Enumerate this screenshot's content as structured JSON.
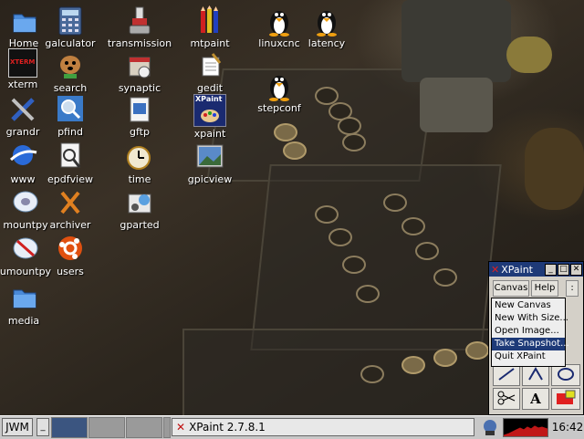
{
  "desktop": {
    "icons": [
      {
        "label": "Home",
        "icon": "folder-icon"
      },
      {
        "label": "galculator",
        "icon": "calculator-icon"
      },
      {
        "label": "transmission",
        "icon": "torrent-icon"
      },
      {
        "label": "mtpaint",
        "icon": "pencils-icon"
      },
      {
        "label": "linuxcnc",
        "icon": "penguin-icon"
      },
      {
        "label": "latency",
        "icon": "penguin-icon"
      },
      {
        "label": "xterm",
        "icon": "terminal-icon"
      },
      {
        "label": "search",
        "icon": "dog-search-icon"
      },
      {
        "label": "synaptic",
        "icon": "package-icon"
      },
      {
        "label": "gedit",
        "icon": "notepad-icon"
      },
      {
        "label": "stepconf",
        "icon": "penguin-icon"
      },
      {
        "label": "grandr",
        "icon": "tools-icon"
      },
      {
        "label": "pfind",
        "icon": "magnifier-icon"
      },
      {
        "label": "gftp",
        "icon": "ftp-icon"
      },
      {
        "label": "xpaint",
        "icon": "palette-icon"
      },
      {
        "label": "www",
        "icon": "globe-icon"
      },
      {
        "label": "epdfview",
        "icon": "pdf-viewer-icon"
      },
      {
        "label": "time",
        "icon": "clock-icon"
      },
      {
        "label": "gpicview",
        "icon": "image-viewer-icon"
      },
      {
        "label": "mountpy",
        "icon": "drive-icon"
      },
      {
        "label": "archiver",
        "icon": "archive-icon"
      },
      {
        "label": "gparted",
        "icon": "partition-icon"
      },
      {
        "label": "umountpy",
        "icon": "unmount-icon"
      },
      {
        "label": "users",
        "icon": "users-icon"
      },
      {
        "label": "media",
        "icon": "folder-icon"
      }
    ],
    "xpaint_logo_text": "XPaint",
    "xterm_logo_text": "XTERM"
  },
  "xpaint_window": {
    "title": "XPaint",
    "menus": {
      "canvas": "Canvas",
      "help": "Help"
    },
    "canvas_menu_items": [
      "New Canvas",
      "New With Size...",
      "Open Image...",
      "Take Snapshot...",
      "Quit XPaint"
    ],
    "highlighted_item": "Take Snapshot...",
    "tools": [
      "line-tool",
      "curve-tool",
      "oval-tool",
      "scissors-tool",
      "text-tool",
      "fill-tool"
    ],
    "text_tool_glyph": "A"
  },
  "taskbar": {
    "menu_button": "JWM",
    "minimize_glyph": "_",
    "pagers": 4,
    "active_pager": 1,
    "task": "XPaint 2.7.8.1",
    "clock": "16:42",
    "colors": {
      "active_pager": "#3b5580",
      "cpu_graph": "#c01818"
    }
  }
}
